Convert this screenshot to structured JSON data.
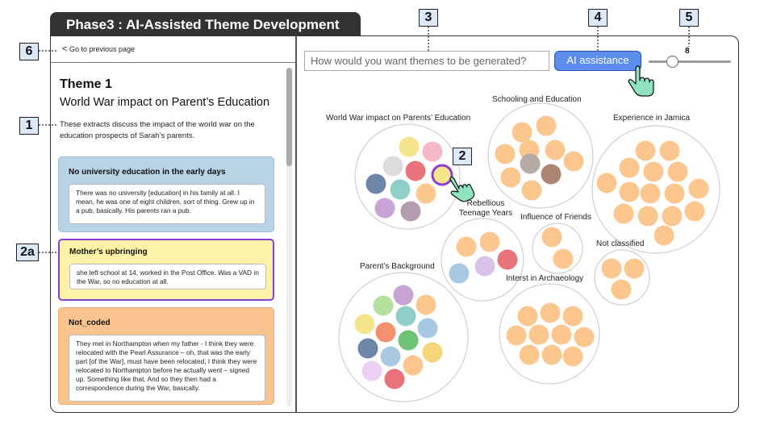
{
  "window": {
    "title": "Phase3 : AI-Assisted Theme Development"
  },
  "nav": {
    "back_label": "Go to previous page"
  },
  "theme": {
    "number_label": "Theme 1",
    "name": "World War impact on Parent’s Education",
    "description": "These extracts discuss the impact of the world war on the education prospects of Sarah’s parents."
  },
  "cards": [
    {
      "title": "No university education in the early days",
      "quote": "There was no university [education] in his family at all.  I mean, he was one of eight children, sort of thing.  Grew up in a pub, basically.  His parents ran a pub."
    },
    {
      "title": "Mother’s upbringing",
      "quote": "she left school at 14, worked in the Post Office. Was a VAD in the War, so no education at all."
    },
    {
      "title": "Not_coded",
      "quote": "They met in Northampton when my father - I think they were relocated with the Pearl Assurance – oh, that was the early part [of the War], must have been relocated, I think they were relocated to Northampton before he actually went – signed up. Something like that. And so they then had a correspondence during the War, basically."
    }
  ],
  "search": {
    "placeholder": "How would you want themes to be generated?"
  },
  "ai_button": {
    "label": "AI assistance"
  },
  "slider": {
    "value": "8",
    "level_fraction": 0.22
  },
  "markers": {
    "m1": "1",
    "m2": "2",
    "m2a": "2a",
    "m3": "3",
    "m4": "4",
    "m5": "5",
    "m6": "6"
  },
  "clusters": [
    {
      "label": "World War impact on Parents’ Education"
    },
    {
      "label": "Schooling and Education"
    },
    {
      "label": "Experience in Jamica"
    },
    {
      "label": "Rebellious\nTeenage Years"
    },
    {
      "label": "Influence of Friends"
    },
    {
      "label": "Not classified"
    },
    {
      "label": "Parent’s Background"
    },
    {
      "label": "Interst in Archaeology"
    }
  ],
  "colors": {
    "card_blue": "#b8d3e6",
    "card_yellow": "#fdf3a8",
    "card_orange": "#f9c490",
    "highlight_border": "#8a3fd0",
    "ai_button": "#5b8ded",
    "dot_default": "#fcc78f",
    "cursor_green": "#8fe3c0"
  }
}
